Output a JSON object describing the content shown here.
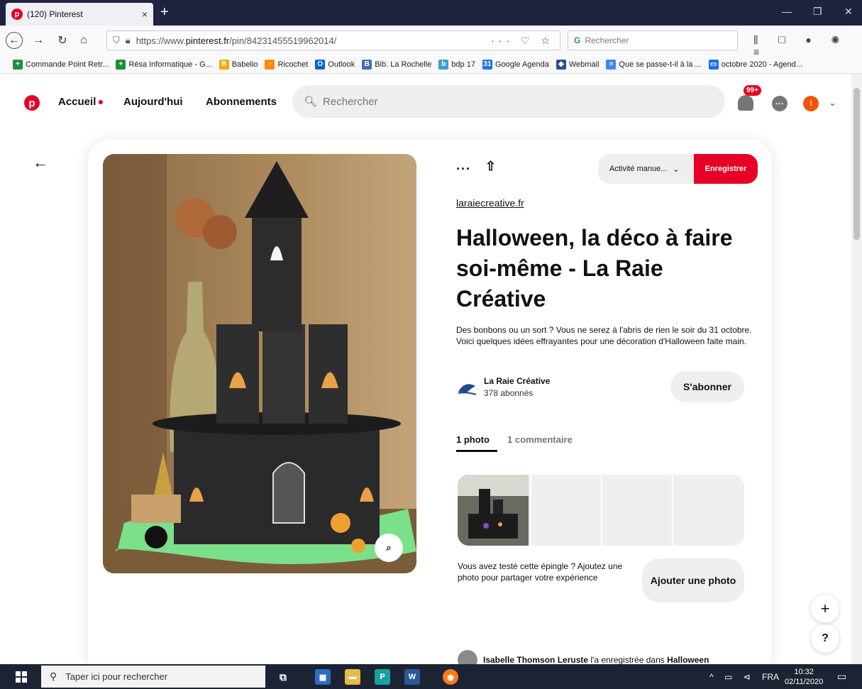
{
  "browser": {
    "tab_title": "(120) Pinterest",
    "tab_close": "×",
    "new_tab": "+",
    "url_prefix": "https://www.",
    "url_host": "pinterest.fr",
    "url_path": "/pin/842314555199620​14/",
    "url_actions": "··· ♡ ☆",
    "search_placeholder": "Rechercher",
    "search_engine_glyph": "G",
    "win_min": "—",
    "win_max": "❐",
    "win_close": "✕",
    "toolbar_icons": "⫼ ▢ ● ◉ ≡"
  },
  "bookmarks": [
    {
      "label": "Commande Point Retr...",
      "color": "#1f8f3a",
      "glyph": "+"
    },
    {
      "label": "Résa Informatique - G...",
      "color": "#1f8f3a",
      "glyph": "+"
    },
    {
      "label": "Babelio",
      "color": "#f2a900",
      "glyph": "B"
    },
    {
      "label": "Ricochet",
      "color": "#ff8a00",
      "glyph": "↑"
    },
    {
      "label": "Outlook",
      "color": "#0a64c8",
      "glyph": "O"
    },
    {
      "label": "Bib. La Rochelle",
      "color": "#3a6fb0",
      "glyph": "B"
    },
    {
      "label": "bdp 17",
      "color": "#3aa0d0",
      "glyph": "b"
    },
    {
      "label": "Google Agenda",
      "color": "#1a73e8",
      "glyph": "31"
    },
    {
      "label": "Webmail",
      "color": "#2d4a9a",
      "glyph": "◆"
    },
    {
      "label": "Que se passe-t-il à la ...",
      "color": "#4285f4",
      "glyph": "≡"
    },
    {
      "label": "octobre 2020 - Agend...",
      "color": "#1a73e8",
      "glyph": "▭"
    }
  ],
  "pinterest": {
    "logo": "p",
    "nav_home": "Accueil",
    "nav_today": "Aujourd'hui",
    "nav_following": "Abonnements",
    "search_placeholder": "Rechercher",
    "notif_badge": "99+",
    "chat_glyph": "···",
    "avatar_initial": "I",
    "menu_chevron": "⌄"
  },
  "pin": {
    "back": "←",
    "more": "···",
    "share": "⇧",
    "board": "Activité manue...",
    "board_chevron": "⌄",
    "save": "Enregistrer",
    "source": "laraiecreative.fr",
    "title": "Halloween, la déco à faire soi-même - La Raie Créative",
    "description": "Des bonbons ou un sort ? Vous ne serez à l'abris de rien le soir du 31 octobre. Voici quelques idées effrayantes pour une décoration d'Halloween faite main.",
    "creator_name": "La Raie Créative",
    "creator_followers": "378 abonnés",
    "follow": "S'abonner",
    "tab_photos": "1 photo",
    "tab_comments": "1 commentaire",
    "tried_text": "Vous avez testé cette épingle ? Ajoutez une photo pour partager votre expérience",
    "add_photo": "Ajouter une photo",
    "activity_user": "Isabelle Thomson Leruste",
    "activity_text": " l'a enregistrée dans ",
    "activity_board": "Halloween",
    "lens": "⌕"
  },
  "fab": {
    "plus": "+",
    "help": "?"
  },
  "taskbar": {
    "search_placeholder": "Taper ici pour rechercher",
    "tray_icons": "^ ▭ ⊲",
    "lang": "FRA",
    "time": "10:32",
    "date": "02/11/2020",
    "notif": "▭"
  }
}
